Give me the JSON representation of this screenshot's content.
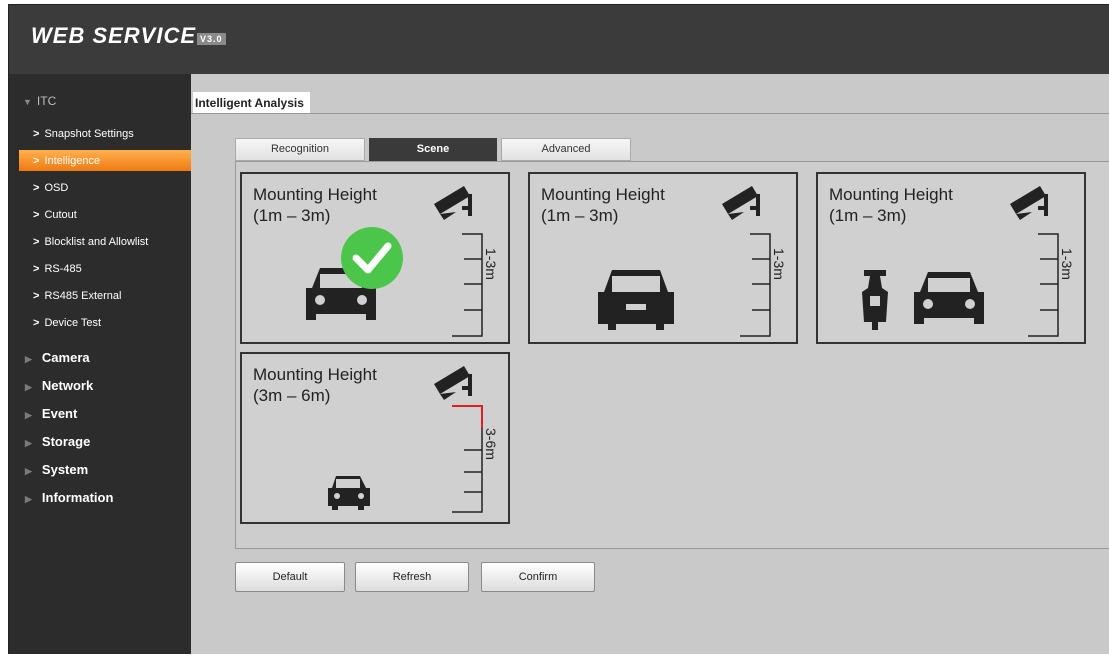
{
  "app": {
    "logo_text": "WEB SERVICE",
    "logo_version": "V3.0"
  },
  "sidebar": {
    "root_label": "ITC",
    "sub_items": [
      {
        "label": "Snapshot Settings"
      },
      {
        "label": "Intelligence",
        "active": true
      },
      {
        "label": "OSD"
      },
      {
        "label": "Cutout"
      },
      {
        "label": "Blocklist and Allowlist"
      },
      {
        "label": "RS-485"
      },
      {
        "label": "RS485 External"
      },
      {
        "label": "Device Test"
      }
    ],
    "main_items": [
      {
        "label": "Camera"
      },
      {
        "label": "Network"
      },
      {
        "label": "Event"
      },
      {
        "label": "Storage"
      },
      {
        "label": "System"
      },
      {
        "label": "Information"
      }
    ],
    "active_color": "#f28a1e"
  },
  "main": {
    "title": "Intelligent Analysis",
    "tabs": [
      {
        "label": "Recognition"
      },
      {
        "label": "Scene",
        "active": true
      },
      {
        "label": "Advanced"
      }
    ],
    "scenes": [
      {
        "title": "Mounting Height\n(1m – 3m)",
        "scale_label": "1-3m",
        "selected": true
      },
      {
        "title": "Mounting Height\n(1m – 3m)",
        "scale_label": "1-3m",
        "selected": false
      },
      {
        "title": "Mounting Height\n(1m – 3m)",
        "scale_label": "1-3m",
        "selected": false
      },
      {
        "title": "Mounting Height\n(3m – 6m)",
        "scale_label": "3-6m",
        "selected": false
      }
    ],
    "buttons": {
      "default_label": "Default",
      "refresh_label": "Refresh",
      "confirm_label": "Confirm"
    }
  },
  "colors": {
    "selected_check": "#4cc64a",
    "scale_highlight": "#e02020"
  }
}
